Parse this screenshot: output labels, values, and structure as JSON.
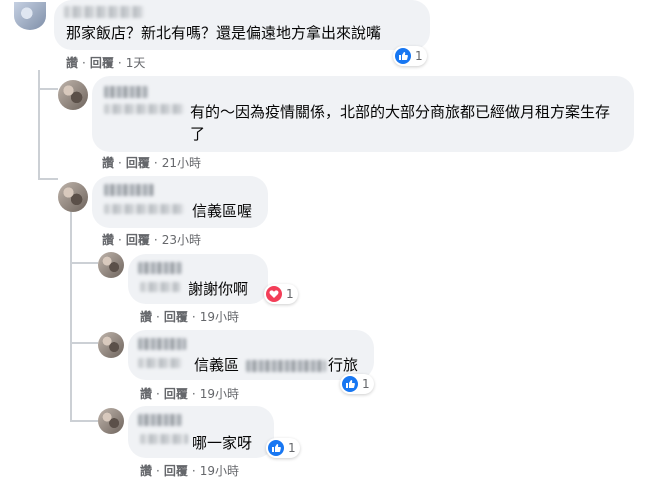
{
  "actions": {
    "like": "讚",
    "reply": "回覆"
  },
  "comments": [
    {
      "text": "那家飯店？新北有嗎？還是偏遠地方拿出來說嘴",
      "time": "1天",
      "reaction": {
        "type": "like",
        "count": "1"
      }
    },
    {
      "text": "有的～因為疫情關係，北部的大部分商旅都已經做月租方案生存了",
      "time": "21小時"
    },
    {
      "text": "信義區喔",
      "time": "23小時"
    },
    {
      "text": "謝謝你啊",
      "time": "19小時",
      "reaction": {
        "type": "love",
        "count": "1"
      }
    },
    {
      "text_a": "信義區",
      "text_b": "行旅",
      "time": "19小時",
      "reaction": {
        "type": "like",
        "count": "1"
      }
    },
    {
      "text": "哪一家呀",
      "time": "19小時",
      "reaction": {
        "type": "like",
        "count": "1"
      }
    }
  ]
}
